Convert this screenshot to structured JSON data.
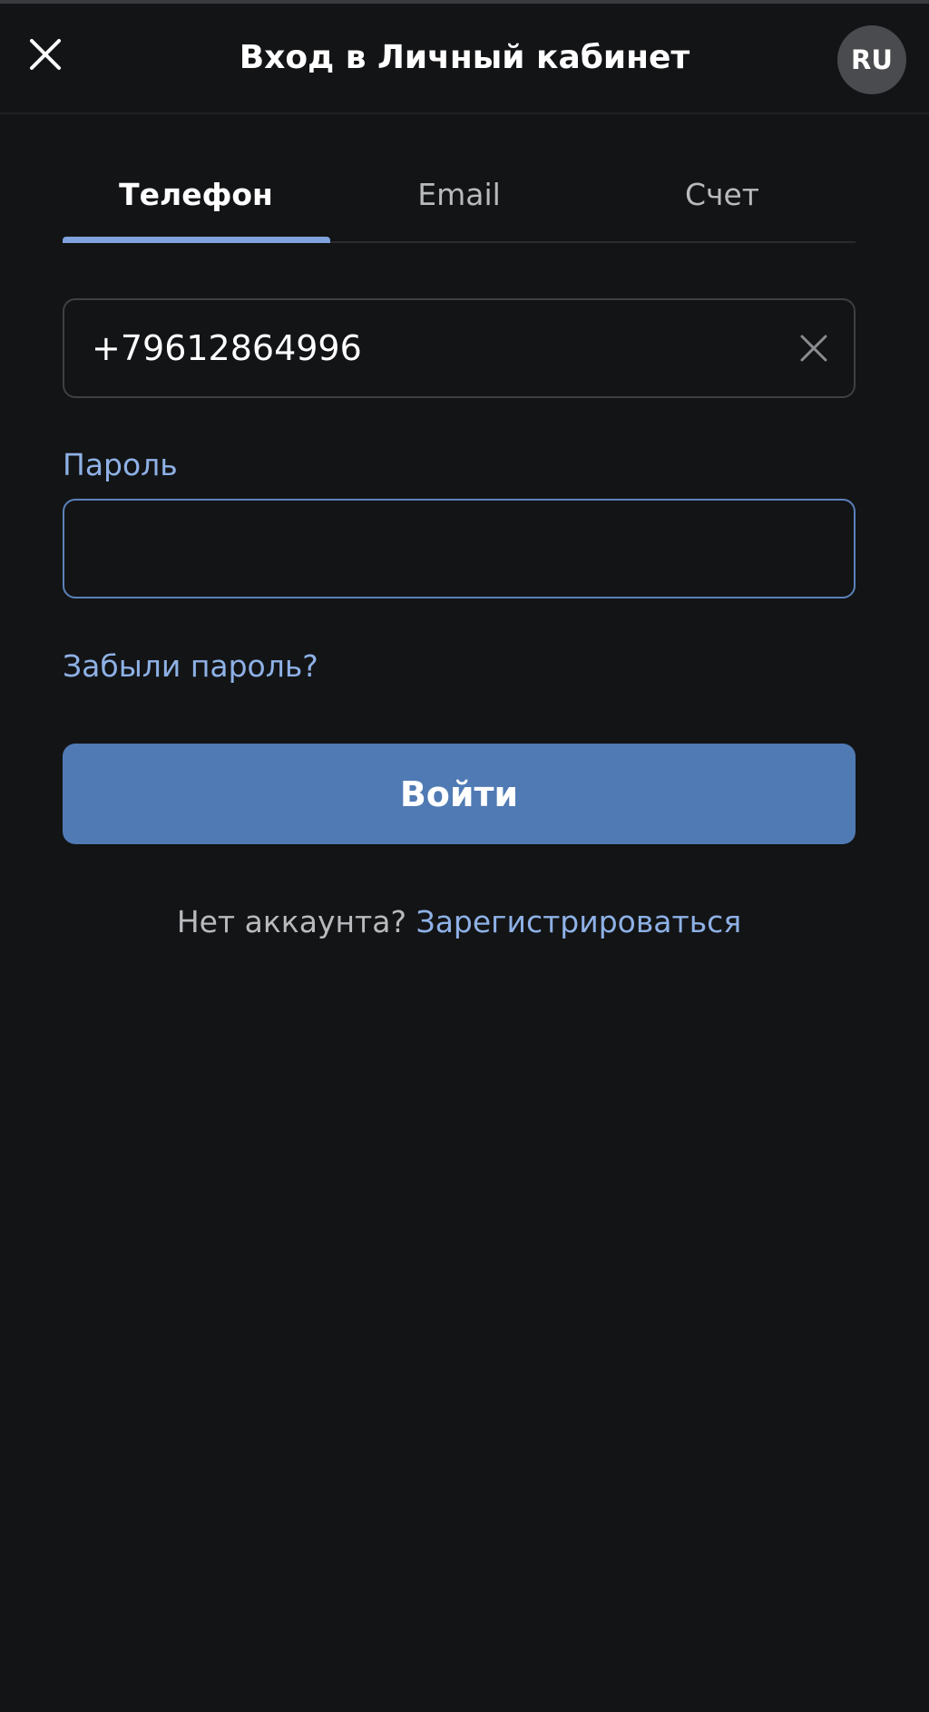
{
  "header": {
    "title": "Вход в Личный кабинет",
    "language": "RU"
  },
  "tabs": [
    {
      "label": "Телефон",
      "active": true
    },
    {
      "label": "Email",
      "active": false
    },
    {
      "label": "Счет",
      "active": false
    }
  ],
  "phone": {
    "value": "+79612864996"
  },
  "password": {
    "label": "Пароль",
    "value": ""
  },
  "forgot_password": "Забыли пароль?",
  "login_button": "Войти",
  "signup": {
    "prompt": "Нет аккаунта?",
    "link": "Зарегистрироваться"
  },
  "icons": {
    "close": "close-icon",
    "clear": "clear-icon"
  },
  "colors": {
    "background": "#131416",
    "accent": "#7fa3dc",
    "link": "#8eb1e6",
    "button": "#507ab4",
    "input_focus_border": "#5b82bb"
  }
}
